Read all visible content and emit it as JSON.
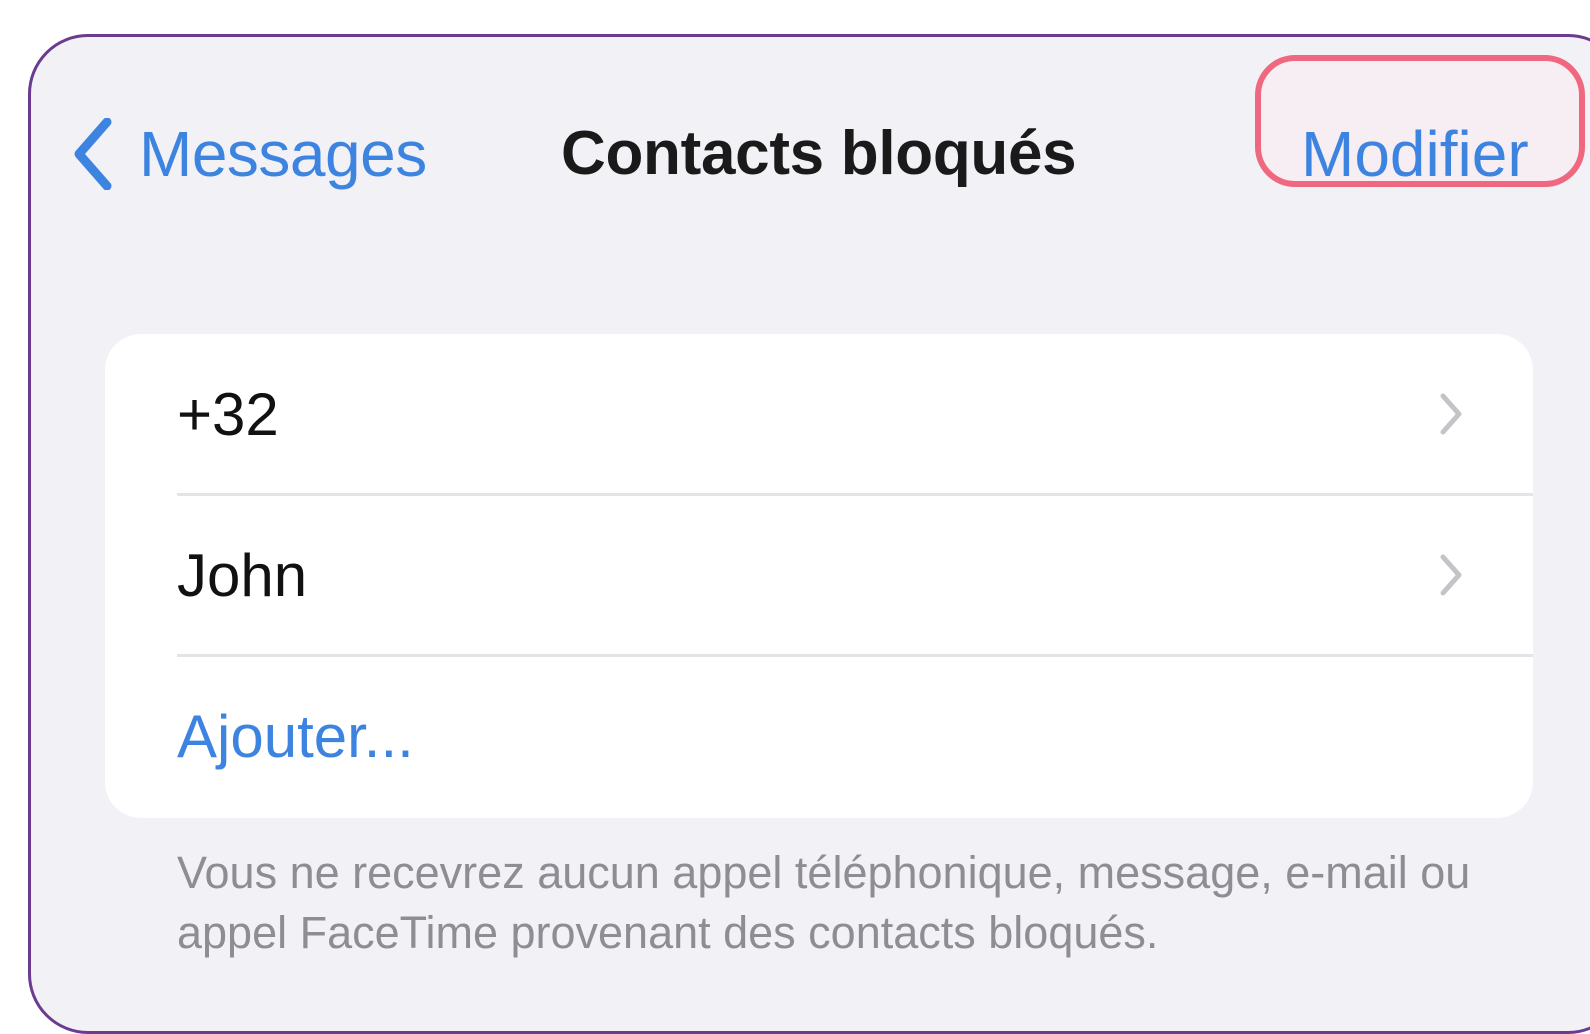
{
  "nav": {
    "back_label": "Messages",
    "title": "Contacts bloqués",
    "edit_label": "Modifier"
  },
  "blocked_list": {
    "items": [
      {
        "label": "+32"
      },
      {
        "label": "John"
      }
    ],
    "add_label": "Ajouter..."
  },
  "footnote": "Vous ne recevrez aucun appel téléphonique, message, e-mail ou appel FaceTime provenant des contacts bloqués.",
  "colors": {
    "accent": "#3d84e0",
    "background": "#f2f1f6",
    "highlight": "#f0687f",
    "frame_border": "#6a3b8f"
  },
  "icons": {
    "back": "chevron-left-icon",
    "row_disclosure": "chevron-right-icon"
  }
}
